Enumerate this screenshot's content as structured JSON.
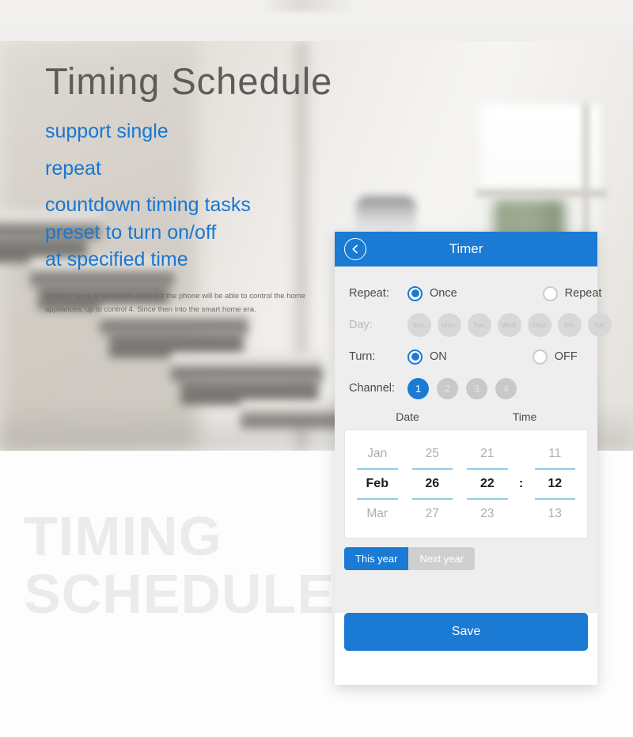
{
  "hero": {
    "title": "Timing Schedule",
    "lines": [
      "support single",
      "repeat",
      "countdown timing tasks",
      "preset to turn on/off",
      "at specified time"
    ],
    "fine_print": "Whether work or exclusive, take out the phone will be able to control the home appliances, up to control 4. Since then into the smart home era.",
    "watermark_line1": "TIMING",
    "watermark_line2": "SCHEDULE",
    "accent_color": "#1976d2",
    "title_color": "#5e5c59"
  },
  "panel": {
    "header": {
      "title": "Timer",
      "back_icon": "chevron-left-icon",
      "bg_color": "#1a7ad4"
    },
    "repeat": {
      "label": "Repeat:",
      "options": [
        {
          "label": "Once",
          "selected": true
        },
        {
          "label": "Repeat",
          "selected": false
        }
      ]
    },
    "day": {
      "label": "Day:",
      "enabled": false,
      "chips": [
        "Sun.",
        "Mon.",
        "Tue.",
        "Wed.",
        "Thur.",
        "Fri.",
        "Sat."
      ]
    },
    "turn": {
      "label": "Turn:",
      "options": [
        {
          "label": "ON",
          "selected": true
        },
        {
          "label": "OFF",
          "selected": false
        }
      ]
    },
    "channel": {
      "label": "Channel:",
      "items": [
        {
          "label": "1",
          "selected": true
        },
        {
          "label": "2",
          "selected": false
        },
        {
          "label": "3",
          "selected": false
        },
        {
          "label": "4",
          "selected": false
        }
      ]
    },
    "picker": {
      "date_header": "Date",
      "time_header": "Time",
      "time_separator": ":",
      "columns": [
        {
          "name": "month",
          "prev": "Jan",
          "current": "Feb",
          "next": "Mar"
        },
        {
          "name": "day",
          "prev": "25",
          "current": "26",
          "next": "27"
        },
        {
          "name": "hour",
          "prev": "21",
          "current": "22",
          "next": "23"
        },
        {
          "name": "minute",
          "prev": "11",
          "current": "12",
          "next": "13"
        }
      ]
    },
    "year_toggle": [
      {
        "label": "This year",
        "selected": true
      },
      {
        "label": "Next year",
        "selected": false
      }
    ],
    "save_label": "Save"
  }
}
